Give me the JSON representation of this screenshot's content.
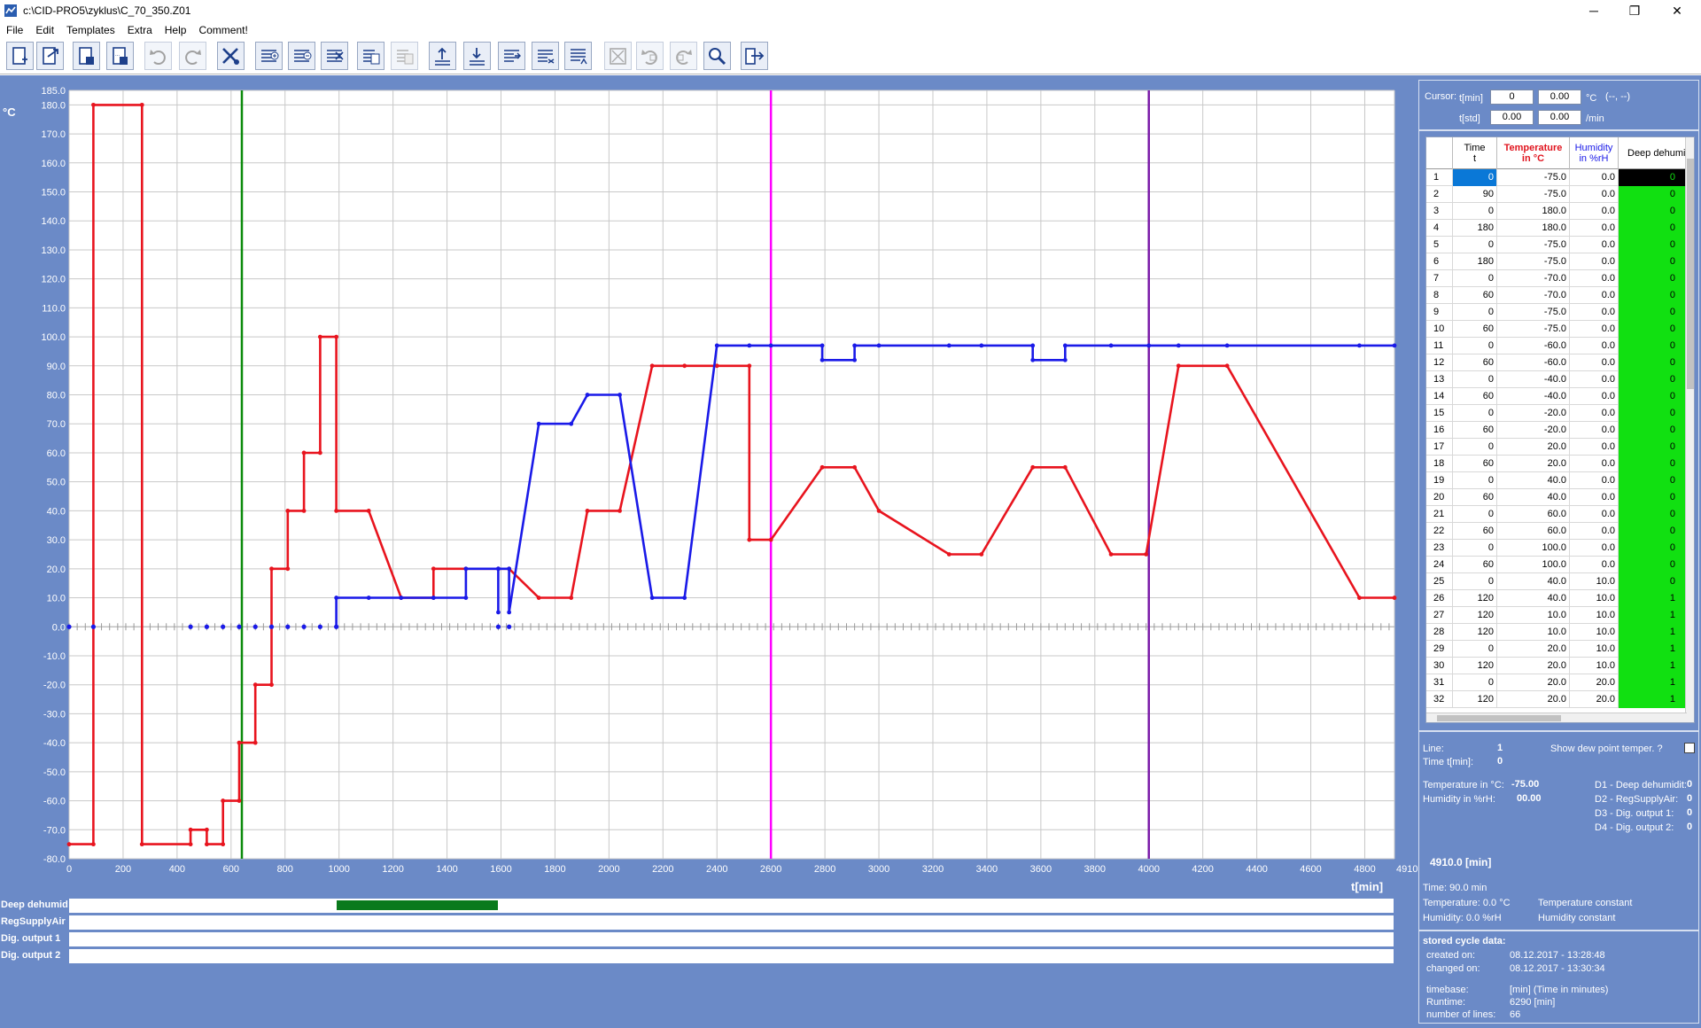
{
  "window": {
    "title": "c:\\CID-PRO5\\zyklus\\C_70_350.Z01",
    "minimize": "─",
    "restore": "❐",
    "close": "✕"
  },
  "menu": [
    "File",
    "Edit",
    "Templates",
    "Extra",
    "Help",
    "Comment!"
  ],
  "toolbar": [
    {
      "name": "new-file-icon",
      "enabled": true
    },
    {
      "name": "open-file-icon",
      "enabled": true
    },
    {
      "name": "save-file-icon",
      "enabled": true
    },
    {
      "name": "save-as-icon",
      "enabled": true
    },
    {
      "name": "undo-icon",
      "enabled": false
    },
    {
      "name": "redo-icon",
      "enabled": false
    },
    {
      "name": "settings-tools-icon",
      "enabled": true
    },
    {
      "name": "insert-line-icon",
      "enabled": true
    },
    {
      "name": "delete-line-icon",
      "enabled": true
    },
    {
      "name": "cut-line-icon",
      "enabled": true
    },
    {
      "name": "copy-line-icon",
      "enabled": true
    },
    {
      "name": "paste-line-icon",
      "enabled": false
    },
    {
      "name": "import-icon",
      "enabled": true
    },
    {
      "name": "export-icon",
      "enabled": true
    },
    {
      "name": "sort-icon",
      "enabled": true
    },
    {
      "name": "line-transform-icon",
      "enabled": true
    },
    {
      "name": "line-edit-icon",
      "enabled": true
    },
    {
      "name": "zoom-fit-icon",
      "enabled": false
    },
    {
      "name": "zoom-undo-icon",
      "enabled": false
    },
    {
      "name": "zoom-redo-icon",
      "enabled": false
    },
    {
      "name": "zoom-magnify-icon",
      "enabled": true
    },
    {
      "name": "exit-icon",
      "enabled": true
    }
  ],
  "chart_data": {
    "type": "line",
    "ylabel": "°C",
    "xlabel": "t[min]",
    "xlim": [
      0,
      4910
    ],
    "ylim": [
      -80,
      185
    ],
    "x_ticks": [
      0,
      200,
      400,
      600,
      800,
      1000,
      1200,
      1400,
      1600,
      1800,
      2000,
      2200,
      2400,
      2600,
      2800,
      3000,
      3200,
      3400,
      3600,
      3800,
      4000,
      4200,
      4400,
      4600,
      4800,
      4910
    ],
    "y_ticks": [
      -80,
      -70,
      -60,
      -50,
      -40,
      -30,
      -20,
      -10,
      0,
      10,
      20,
      30,
      40,
      50,
      60,
      70,
      80,
      90,
      100,
      110,
      120,
      130,
      140,
      150,
      160,
      170,
      180,
      185
    ],
    "grid": true,
    "markers": [
      {
        "name": "green-cursor",
        "x": 640,
        "color": "#0a8a0a"
      },
      {
        "name": "magenta-marker",
        "x": 2600,
        "color": "#ff00ff"
      },
      {
        "name": "purple-marker",
        "x": 4000,
        "color": "#7a1aa8"
      }
    ],
    "series": [
      {
        "name": "Temperature in °C",
        "color": "#e8141e",
        "points": [
          [
            0,
            -75
          ],
          [
            90,
            -75
          ],
          [
            90,
            180
          ],
          [
            270,
            180
          ],
          [
            270,
            -75
          ],
          [
            450,
            -75
          ],
          [
            450,
            -70
          ],
          [
            510,
            -70
          ],
          [
            510,
            -75
          ],
          [
            570,
            -75
          ],
          [
            570,
            -60
          ],
          [
            630,
            -60
          ],
          [
            630,
            -40
          ],
          [
            690,
            -40
          ],
          [
            690,
            -20
          ],
          [
            750,
            -20
          ],
          [
            750,
            20
          ],
          [
            810,
            20
          ],
          [
            810,
            40
          ],
          [
            870,
            40
          ],
          [
            870,
            60
          ],
          [
            930,
            60
          ],
          [
            930,
            100
          ],
          [
            990,
            100
          ],
          [
            990,
            40
          ],
          [
            1110,
            40
          ],
          [
            1230,
            10
          ],
          [
            1350,
            10
          ],
          [
            1350,
            20
          ],
          [
            1470,
            20
          ],
          [
            1590,
            20
          ],
          [
            1630,
            20
          ],
          [
            1740,
            10
          ],
          [
            1860,
            10
          ],
          [
            1920,
            40
          ],
          [
            2040,
            40
          ],
          [
            2160,
            90
          ],
          [
            2280,
            90
          ],
          [
            2400,
            90
          ],
          [
            2520,
            90
          ],
          [
            2520,
            30
          ],
          [
            2600,
            30
          ],
          [
            2790,
            55
          ],
          [
            2910,
            55
          ],
          [
            3000,
            40
          ],
          [
            3260,
            25
          ],
          [
            3380,
            25
          ],
          [
            3570,
            55
          ],
          [
            3690,
            55
          ],
          [
            3860,
            25
          ],
          [
            3990,
            25
          ],
          [
            4110,
            90
          ],
          [
            4290,
            90
          ],
          [
            4780,
            10
          ],
          [
            4910,
            10
          ]
        ]
      },
      {
        "name": "Humidity in %rH",
        "color": "#1a1ae8",
        "points": [
          [
            990,
            0
          ],
          [
            990,
            10
          ],
          [
            1110,
            10
          ],
          [
            1230,
            10
          ],
          [
            1350,
            10
          ],
          [
            1470,
            10
          ],
          [
            1470,
            20
          ],
          [
            1590,
            20
          ],
          [
            1590,
            5
          ],
          [
            1590,
            20
          ],
          [
            1630,
            20
          ],
          [
            1630,
            5
          ],
          [
            1740,
            70
          ],
          [
            1860,
            70
          ],
          [
            1920,
            80
          ],
          [
            2040,
            80
          ],
          [
            2160,
            10
          ],
          [
            2280,
            10
          ],
          [
            2400,
            97
          ],
          [
            2520,
            97
          ],
          [
            2600,
            97
          ],
          [
            2790,
            97
          ],
          [
            2790,
            92
          ],
          [
            2910,
            92
          ],
          [
            2910,
            97
          ],
          [
            3000,
            97
          ],
          [
            3260,
            97
          ],
          [
            3380,
            97
          ],
          [
            3570,
            97
          ],
          [
            3570,
            92
          ],
          [
            3690,
            92
          ],
          [
            3690,
            97
          ],
          [
            3860,
            97
          ],
          [
            4000,
            97
          ],
          [
            4110,
            97
          ],
          [
            4290,
            97
          ],
          [
            4780,
            97
          ],
          [
            4910,
            97
          ]
        ]
      }
    ],
    "zero_line_dots_x": [
      0,
      90,
      450,
      510,
      570,
      630,
      690,
      750,
      810,
      870,
      930,
      990,
      1590,
      1630
    ]
  },
  "digital_outputs": [
    {
      "label": "Deep dehumid",
      "segments": [
        [
          990,
          1590
        ]
      ]
    },
    {
      "label": "RegSupplyAir",
      "segments": []
    },
    {
      "label": "Dig. output 1",
      "segments": []
    },
    {
      "label": "Dig. output 2",
      "segments": []
    }
  ],
  "cursor": {
    "label": "Cursor:",
    "t_min_label": "t[min]",
    "t_min_value": "0",
    "temp_value": "0.00",
    "temp_unit": "°C",
    "coord_text": "(--, --)",
    "t_std_label": "t[std]",
    "t_std_value": "0.00",
    "rate_value": "0.00",
    "rate_unit": "/min"
  },
  "table": {
    "headers": {
      "time": "Time",
      "time_sub": "t",
      "temp": "Temperature",
      "temp_sub": "in °C",
      "hum": "Humidity",
      "hum_sub": "in %rH",
      "deep": "Deep dehumid"
    },
    "colors": {
      "temp": "#e0141e",
      "hum": "#1a1ae8"
    },
    "selected_row": 1,
    "rows": [
      [
        "1",
        "0",
        "-75.0",
        "0.0",
        "0"
      ],
      [
        "2",
        "90",
        "-75.0",
        "0.0",
        "0"
      ],
      [
        "3",
        "0",
        "180.0",
        "0.0",
        "0"
      ],
      [
        "4",
        "180",
        "180.0",
        "0.0",
        "0"
      ],
      [
        "5",
        "0",
        "-75.0",
        "0.0",
        "0"
      ],
      [
        "6",
        "180",
        "-75.0",
        "0.0",
        "0"
      ],
      [
        "7",
        "0",
        "-70.0",
        "0.0",
        "0"
      ],
      [
        "8",
        "60",
        "-70.0",
        "0.0",
        "0"
      ],
      [
        "9",
        "0",
        "-75.0",
        "0.0",
        "0"
      ],
      [
        "10",
        "60",
        "-75.0",
        "0.0",
        "0"
      ],
      [
        "11",
        "0",
        "-60.0",
        "0.0",
        "0"
      ],
      [
        "12",
        "60",
        "-60.0",
        "0.0",
        "0"
      ],
      [
        "13",
        "0",
        "-40.0",
        "0.0",
        "0"
      ],
      [
        "14",
        "60",
        "-40.0",
        "0.0",
        "0"
      ],
      [
        "15",
        "0",
        "-20.0",
        "0.0",
        "0"
      ],
      [
        "16",
        "60",
        "-20.0",
        "0.0",
        "0"
      ],
      [
        "17",
        "0",
        "20.0",
        "0.0",
        "0"
      ],
      [
        "18",
        "60",
        "20.0",
        "0.0",
        "0"
      ],
      [
        "19",
        "0",
        "40.0",
        "0.0",
        "0"
      ],
      [
        "20",
        "60",
        "40.0",
        "0.0",
        "0"
      ],
      [
        "21",
        "0",
        "60.0",
        "0.0",
        "0"
      ],
      [
        "22",
        "60",
        "60.0",
        "0.0",
        "0"
      ],
      [
        "23",
        "0",
        "100.0",
        "0.0",
        "0"
      ],
      [
        "24",
        "60",
        "100.0",
        "0.0",
        "0"
      ],
      [
        "25",
        "0",
        "40.0",
        "10.0",
        "0"
      ],
      [
        "26",
        "120",
        "40.0",
        "10.0",
        "1"
      ],
      [
        "27",
        "120",
        "10.0",
        "10.0",
        "1"
      ],
      [
        "28",
        "120",
        "10.0",
        "10.0",
        "1"
      ],
      [
        "29",
        "0",
        "20.0",
        "10.0",
        "1"
      ],
      [
        "30",
        "120",
        "20.0",
        "10.0",
        "1"
      ],
      [
        "31",
        "0",
        "20.0",
        "20.0",
        "1"
      ],
      [
        "32",
        "120",
        "20.0",
        "20.0",
        "1"
      ]
    ]
  },
  "line_info": {
    "line_label": "Line:",
    "line_value": "1",
    "time_label": "Time t[min]:",
    "time_value": "0",
    "dew_label": "Show dew point temper. ?",
    "temp_label": "Temperature in °C:",
    "temp_value": "-75.00",
    "hum_label": "Humidity in %rH:",
    "hum_value": "00.00",
    "d1_label": "D1 - Deep dehumidit:",
    "d1_value": "0",
    "d2_label": "D2 - RegSupplyAir:",
    "d2_value": "0",
    "d3_label": "D3 - Dig. output 1:",
    "d3_value": "0",
    "d4_label": "D4 - Dig. output 2:",
    "d4_value": "0"
  },
  "segment_info": {
    "total": "4910.0 [min]",
    "time": "Time: 90.0 min",
    "temp": "Temperature: 0.0 °C",
    "temp_state": "Temperature constant",
    "hum": "Humidity: 0.0 %rH",
    "hum_state": "Humidity constant"
  },
  "stored": {
    "title": "stored cycle data:",
    "created_label": "created on:",
    "created_value": "08.12.2017 - 13:28:48",
    "changed_label": "changed on:",
    "changed_value": "08.12.2017 - 13:30:34",
    "timebase_label": "timebase:",
    "timebase_value": "[min]  (Time in minutes)",
    "runtime_label": "Runtime:",
    "runtime_value": "6290 [min]",
    "lines_label": "number of lines:",
    "lines_value": "66"
  }
}
